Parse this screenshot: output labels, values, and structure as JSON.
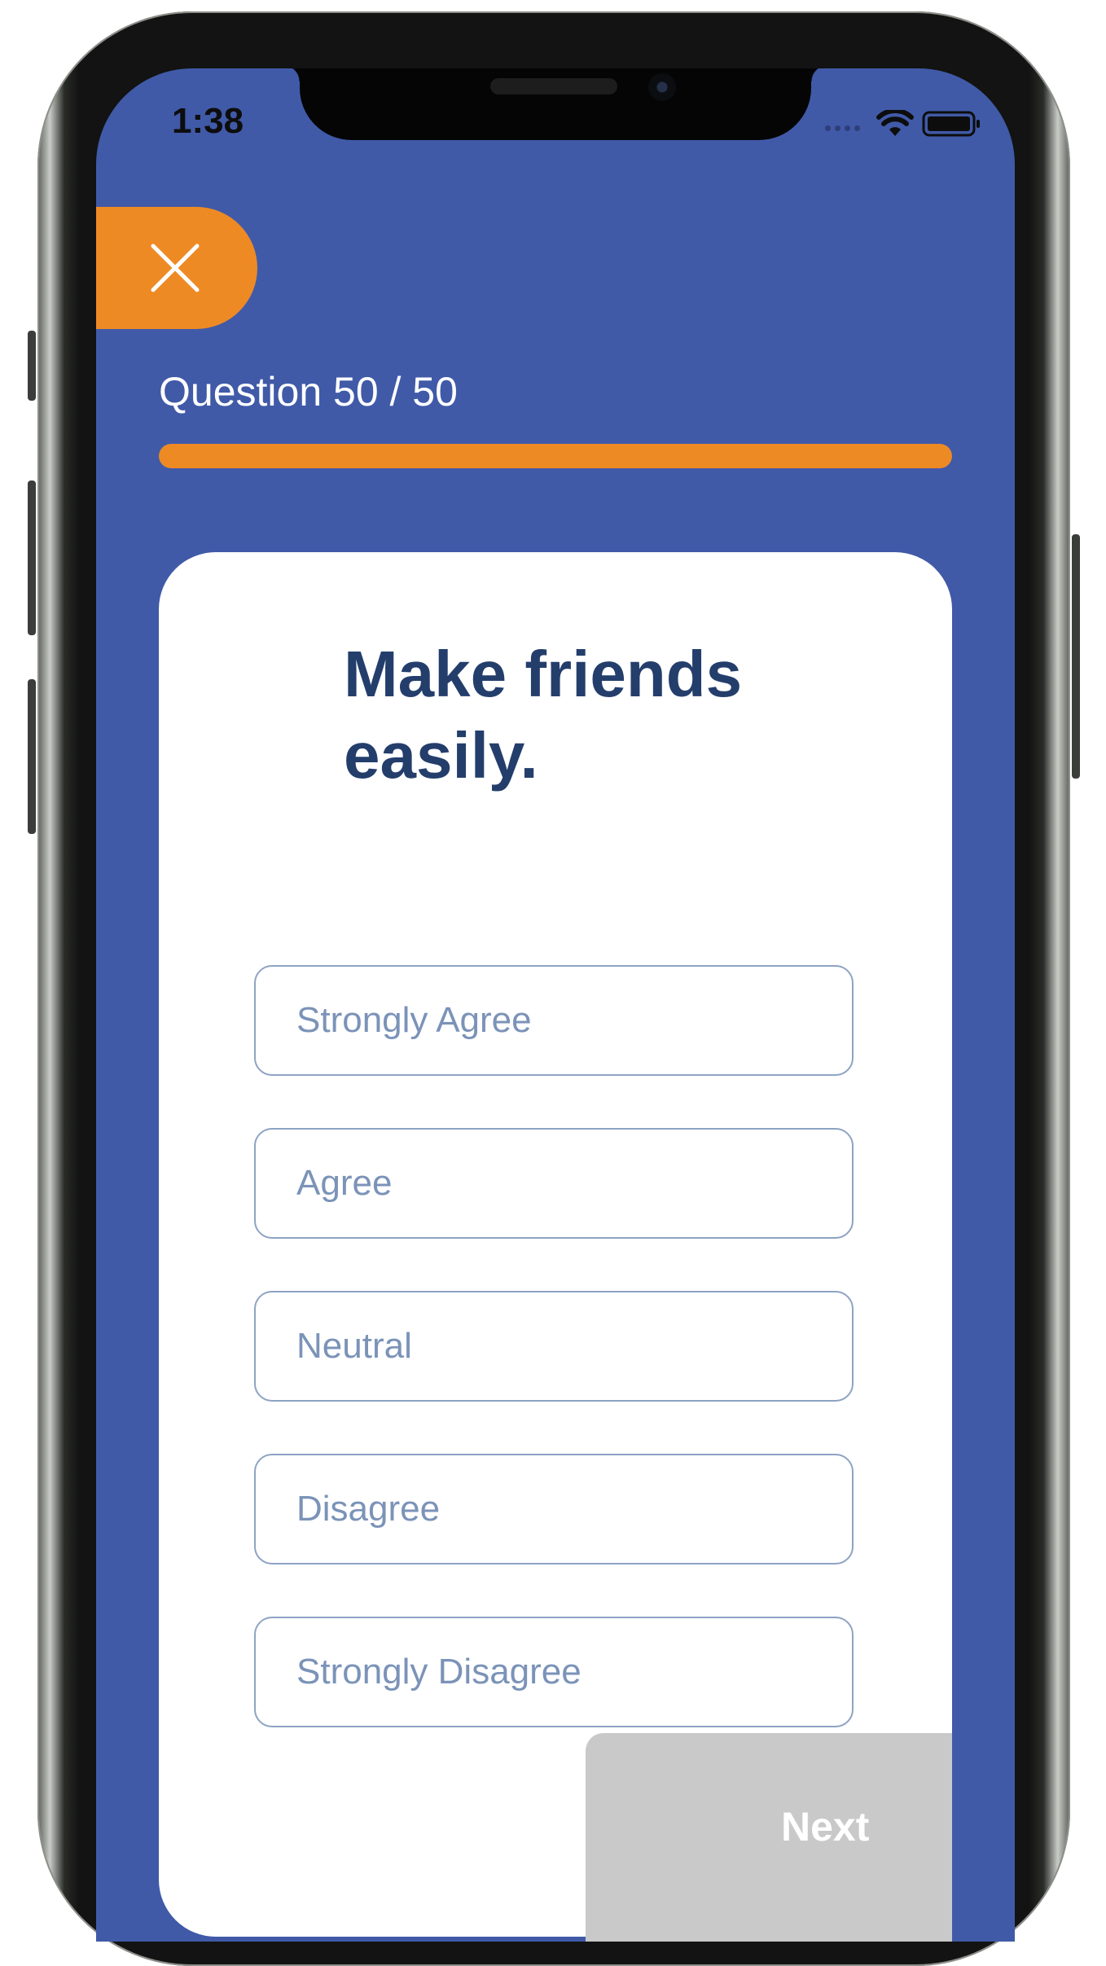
{
  "status_bar": {
    "time": "1:38",
    "icons": [
      "signal-dots-icon",
      "wifi-icon",
      "battery-icon"
    ]
  },
  "close_button": {
    "icon": "close-icon"
  },
  "quiz": {
    "counter": "Question 50 / 50",
    "progress_fraction": 1.0,
    "question": "Make friends easily.",
    "options": [
      "Strongly Agree",
      "Agree",
      "Neutral",
      "Disagree",
      "Strongly Disagree"
    ],
    "next_label": "Next"
  },
  "colors": {
    "background": "#405aa8",
    "accent": "#ee8a24",
    "question_text": "#243e6c",
    "option_text": "#7b93b8",
    "next_disabled": "#c9c9c9"
  }
}
